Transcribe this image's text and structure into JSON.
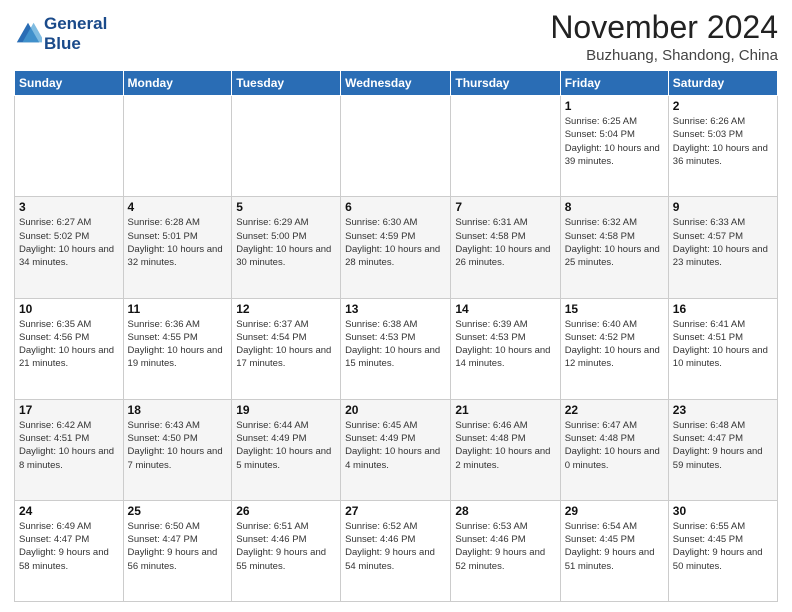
{
  "logo": {
    "line1": "General",
    "line2": "Blue"
  },
  "title": "November 2024",
  "location": "Buzhuang, Shandong, China",
  "days_of_week": [
    "Sunday",
    "Monday",
    "Tuesday",
    "Wednesday",
    "Thursday",
    "Friday",
    "Saturday"
  ],
  "weeks": [
    [
      {
        "day": "",
        "info": ""
      },
      {
        "day": "",
        "info": ""
      },
      {
        "day": "",
        "info": ""
      },
      {
        "day": "",
        "info": ""
      },
      {
        "day": "",
        "info": ""
      },
      {
        "day": "1",
        "info": "Sunrise: 6:25 AM\nSunset: 5:04 PM\nDaylight: 10 hours and 39 minutes."
      },
      {
        "day": "2",
        "info": "Sunrise: 6:26 AM\nSunset: 5:03 PM\nDaylight: 10 hours and 36 minutes."
      }
    ],
    [
      {
        "day": "3",
        "info": "Sunrise: 6:27 AM\nSunset: 5:02 PM\nDaylight: 10 hours and 34 minutes."
      },
      {
        "day": "4",
        "info": "Sunrise: 6:28 AM\nSunset: 5:01 PM\nDaylight: 10 hours and 32 minutes."
      },
      {
        "day": "5",
        "info": "Sunrise: 6:29 AM\nSunset: 5:00 PM\nDaylight: 10 hours and 30 minutes."
      },
      {
        "day": "6",
        "info": "Sunrise: 6:30 AM\nSunset: 4:59 PM\nDaylight: 10 hours and 28 minutes."
      },
      {
        "day": "7",
        "info": "Sunrise: 6:31 AM\nSunset: 4:58 PM\nDaylight: 10 hours and 26 minutes."
      },
      {
        "day": "8",
        "info": "Sunrise: 6:32 AM\nSunset: 4:58 PM\nDaylight: 10 hours and 25 minutes."
      },
      {
        "day": "9",
        "info": "Sunrise: 6:33 AM\nSunset: 4:57 PM\nDaylight: 10 hours and 23 minutes."
      }
    ],
    [
      {
        "day": "10",
        "info": "Sunrise: 6:35 AM\nSunset: 4:56 PM\nDaylight: 10 hours and 21 minutes."
      },
      {
        "day": "11",
        "info": "Sunrise: 6:36 AM\nSunset: 4:55 PM\nDaylight: 10 hours and 19 minutes."
      },
      {
        "day": "12",
        "info": "Sunrise: 6:37 AM\nSunset: 4:54 PM\nDaylight: 10 hours and 17 minutes."
      },
      {
        "day": "13",
        "info": "Sunrise: 6:38 AM\nSunset: 4:53 PM\nDaylight: 10 hours and 15 minutes."
      },
      {
        "day": "14",
        "info": "Sunrise: 6:39 AM\nSunset: 4:53 PM\nDaylight: 10 hours and 14 minutes."
      },
      {
        "day": "15",
        "info": "Sunrise: 6:40 AM\nSunset: 4:52 PM\nDaylight: 10 hours and 12 minutes."
      },
      {
        "day": "16",
        "info": "Sunrise: 6:41 AM\nSunset: 4:51 PM\nDaylight: 10 hours and 10 minutes."
      }
    ],
    [
      {
        "day": "17",
        "info": "Sunrise: 6:42 AM\nSunset: 4:51 PM\nDaylight: 10 hours and 8 minutes."
      },
      {
        "day": "18",
        "info": "Sunrise: 6:43 AM\nSunset: 4:50 PM\nDaylight: 10 hours and 7 minutes."
      },
      {
        "day": "19",
        "info": "Sunrise: 6:44 AM\nSunset: 4:49 PM\nDaylight: 10 hours and 5 minutes."
      },
      {
        "day": "20",
        "info": "Sunrise: 6:45 AM\nSunset: 4:49 PM\nDaylight: 10 hours and 4 minutes."
      },
      {
        "day": "21",
        "info": "Sunrise: 6:46 AM\nSunset: 4:48 PM\nDaylight: 10 hours and 2 minutes."
      },
      {
        "day": "22",
        "info": "Sunrise: 6:47 AM\nSunset: 4:48 PM\nDaylight: 10 hours and 0 minutes."
      },
      {
        "day": "23",
        "info": "Sunrise: 6:48 AM\nSunset: 4:47 PM\nDaylight: 9 hours and 59 minutes."
      }
    ],
    [
      {
        "day": "24",
        "info": "Sunrise: 6:49 AM\nSunset: 4:47 PM\nDaylight: 9 hours and 58 minutes."
      },
      {
        "day": "25",
        "info": "Sunrise: 6:50 AM\nSunset: 4:47 PM\nDaylight: 9 hours and 56 minutes."
      },
      {
        "day": "26",
        "info": "Sunrise: 6:51 AM\nSunset: 4:46 PM\nDaylight: 9 hours and 55 minutes."
      },
      {
        "day": "27",
        "info": "Sunrise: 6:52 AM\nSunset: 4:46 PM\nDaylight: 9 hours and 54 minutes."
      },
      {
        "day": "28",
        "info": "Sunrise: 6:53 AM\nSunset: 4:46 PM\nDaylight: 9 hours and 52 minutes."
      },
      {
        "day": "29",
        "info": "Sunrise: 6:54 AM\nSunset: 4:45 PM\nDaylight: 9 hours and 51 minutes."
      },
      {
        "day": "30",
        "info": "Sunrise: 6:55 AM\nSunset: 4:45 PM\nDaylight: 9 hours and 50 minutes."
      }
    ]
  ]
}
